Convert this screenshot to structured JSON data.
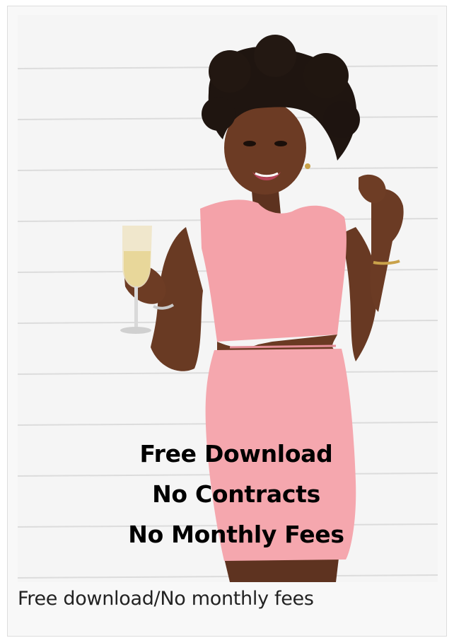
{
  "image": {
    "overlay_lines": [
      "Free Download",
      "No Contracts",
      "No Monthly Fees"
    ]
  },
  "caption": "Free download/No monthly fees",
  "colors": {
    "dress": "#f4a0a8",
    "skin": "#6a3a22",
    "hair": "#1e140f",
    "wall": "#f4f4f4",
    "text": "#000000"
  }
}
